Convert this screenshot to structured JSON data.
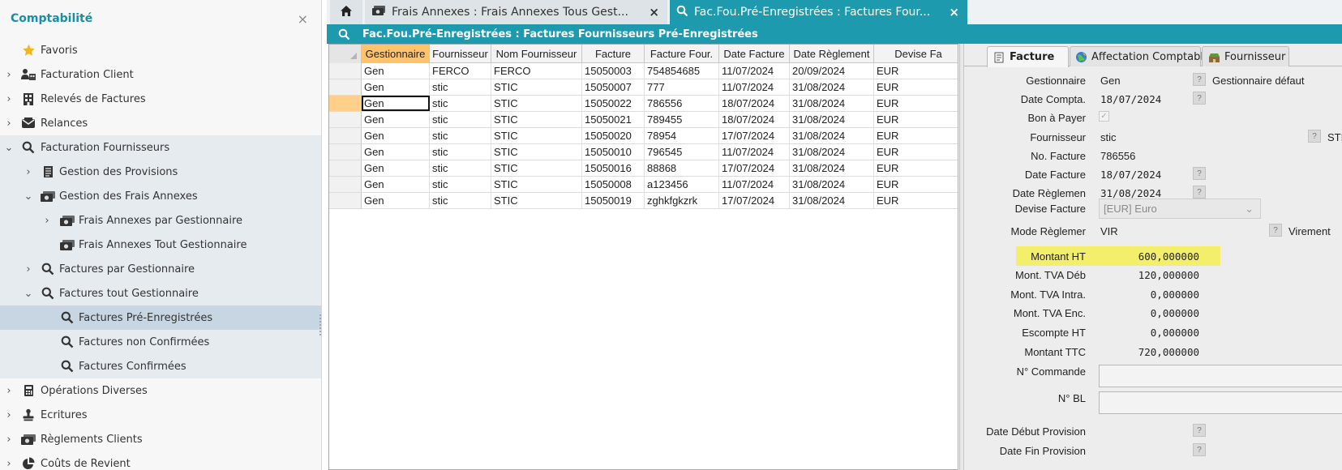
{
  "sidebar": {
    "title": "Comptabilité",
    "close_glyph": "×",
    "items": [
      {
        "label": "Favoris",
        "icon": "star-icon",
        "level": 0,
        "expander": ""
      },
      {
        "label": "Facturation Client",
        "icon": "client-icon",
        "level": 0,
        "expander": "›"
      },
      {
        "label": "Relevés de Factures",
        "icon": "building-icon",
        "level": 0,
        "expander": "›"
      },
      {
        "label": "Relances",
        "icon": "mail-icon",
        "level": 0,
        "expander": "›"
      },
      {
        "label": "Facturation Fournisseurs",
        "icon": "search-icon",
        "level": 0,
        "expander": "⌄"
      },
      {
        "label": "Gestion des Provisions",
        "icon": "document-icon",
        "level": 1,
        "expander": "›"
      },
      {
        "label": "Gestion des Frais Annexes",
        "icon": "money-icon",
        "level": 1,
        "expander": "⌄"
      },
      {
        "label": "Frais Annexes par Gestionnaire",
        "icon": "money-icon",
        "level": 2,
        "expander": "›"
      },
      {
        "label": "Frais Annexes Tout Gestionnaire",
        "icon": "money-icon",
        "level": 2,
        "expander": ""
      },
      {
        "label": "Factures par Gestionnaire",
        "icon": "search-icon",
        "level": 1,
        "expander": "›"
      },
      {
        "label": "Factures tout Gestionnaire",
        "icon": "search-icon",
        "level": 1,
        "expander": "⌄"
      },
      {
        "label": "Factures Pré-Enregistrées",
        "icon": "search-icon",
        "level": 2,
        "expander": ""
      },
      {
        "label": "Factures non Confirmées",
        "icon": "search-icon",
        "level": 2,
        "expander": ""
      },
      {
        "label": "Factures Confirmées",
        "icon": "search-icon",
        "level": 2,
        "expander": ""
      },
      {
        "label": "Opérations Diverses",
        "icon": "calculator-icon",
        "level": 0,
        "expander": "›"
      },
      {
        "label": "Ecritures",
        "icon": "stamp-icon",
        "level": 0,
        "expander": "›"
      },
      {
        "label": "Règlements Clients",
        "icon": "money-icon",
        "level": 0,
        "expander": "›"
      },
      {
        "label": "Coûts de Revient",
        "icon": "pie-icon",
        "level": 0,
        "expander": "›"
      }
    ]
  },
  "tabs": {
    "frais_label": "Frais Annexes : Frais Annexes Tous Gest...",
    "fac_label": "Fac.Fou.Pré-Enregistrées : Factures Four...",
    "close_glyph": "×"
  },
  "titlebar": {
    "text": "Fac.Fou.Pré-Enregistrées : Factures Fournisseurs Pré-Enregistrées"
  },
  "grid": {
    "columns": [
      "Gestionnaire",
      "Fournisseur",
      "Nom Fournisseur",
      "Facture",
      "Facture Four.",
      "Date Facture",
      "Date Règlement",
      "Devise Fa"
    ],
    "rows": [
      [
        "Gen",
        "FERCO",
        "FERCO",
        "15050003",
        "754854685",
        "11/07/2024",
        "20/09/2024",
        "EUR"
      ],
      [
        "Gen",
        "stic",
        "STIC",
        "15050007",
        "777",
        "11/07/2024",
        "31/08/2024",
        "EUR"
      ],
      [
        "Gen",
        "stic",
        "STIC",
        "15050022",
        "786556",
        "18/07/2024",
        "31/08/2024",
        "EUR"
      ],
      [
        "Gen",
        "stic",
        "STIC",
        "15050021",
        "789455",
        "18/07/2024",
        "31/08/2024",
        "EUR"
      ],
      [
        "Gen",
        "stic",
        "STIC",
        "15050020",
        "78954",
        "17/07/2024",
        "31/08/2024",
        "EUR"
      ],
      [
        "Gen",
        "stic",
        "STIC",
        "15050010",
        "796545",
        "11/07/2024",
        "31/08/2024",
        "EUR"
      ],
      [
        "Gen",
        "stic",
        "STIC",
        "15050016",
        "88868",
        "17/07/2024",
        "31/08/2024",
        "EUR"
      ],
      [
        "Gen",
        "stic",
        "STIC",
        "15050008",
        "a123456",
        "11/07/2024",
        "31/08/2024",
        "EUR"
      ],
      [
        "Gen",
        "stic",
        "STIC",
        "15050019",
        "zghkfgkzrk",
        "17/07/2024",
        "31/08/2024",
        "EUR"
      ]
    ]
  },
  "detail": {
    "tabs": [
      "Facture",
      "Affectation Comptable",
      "Fournisseur"
    ],
    "help_glyph": "?",
    "check_glyph": "✓",
    "fields": {
      "gestionnaire": {
        "label": "Gestionnaire",
        "value": "Gen",
        "extra": "Gestionnaire défaut"
      },
      "date_compta": {
        "label": "Date Compta.",
        "value": "18/07/2024"
      },
      "bon_a_payer": {
        "label": "Bon à Payer"
      },
      "fournisseur": {
        "label": "Fournisseur",
        "value": "stic",
        "extra": "STI"
      },
      "no_facture": {
        "label": "No. Facture",
        "value": "786556"
      },
      "date_facture": {
        "label": "Date Facture",
        "value": "18/07/2024"
      },
      "date_reglement": {
        "label": "Date Règlemen",
        "value": "31/08/2024"
      },
      "devise_facture": {
        "label": "Devise Facture",
        "value": "[EUR] Euro"
      },
      "mode_reglement": {
        "label": "Mode Règlemer",
        "value": "VIR",
        "extra": "Virement"
      },
      "montant_ht": {
        "label": "Montant HT",
        "value": "600,000000"
      },
      "mont_tva_deb": {
        "label": "Mont. TVA Déb",
        "value": "120,000000"
      },
      "mont_tva_intra": {
        "label": "Mont. TVA Intra.",
        "value": "0,000000"
      },
      "mont_tva_enc": {
        "label": "Mont. TVA Enc.",
        "value": "0,000000"
      },
      "escompte_ht": {
        "label": "Escompte HT",
        "value": "0,000000"
      },
      "montant_ttc": {
        "label": "Montant TTC",
        "value": "720,000000"
      },
      "n_commande": {
        "label": "N° Commande",
        "value": ""
      },
      "n_bl": {
        "label": "N° BL",
        "value": ""
      },
      "date_debut_provision": {
        "label": "Date Début Provision"
      },
      "date_fin_provision": {
        "label": "Date Fin Provision"
      }
    }
  },
  "colors": {
    "accent": "#1e9aae",
    "selected_header": "#ffc36b",
    "highlight": "#f3ef6a"
  }
}
